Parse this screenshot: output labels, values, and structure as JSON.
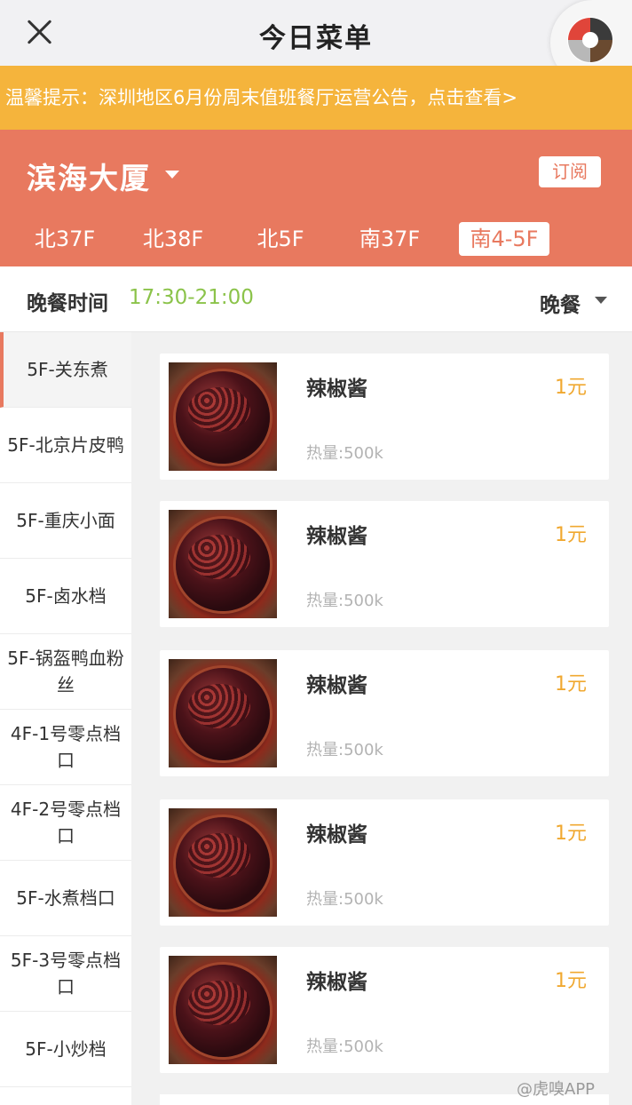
{
  "header": {
    "title": "今日菜单"
  },
  "notice": {
    "text": "温馨提示：深圳地区6月份周末值班餐厅运营公告，点击查看>"
  },
  "location": {
    "building": "滨海大厦",
    "subscribe_label": "订阅",
    "floors": [
      "北37F",
      "北38F",
      "北5F",
      "南37F",
      "南4-5F"
    ],
    "active_floor": "南4-5F"
  },
  "meal": {
    "time_label": "晚餐时间",
    "time_range": "17:30-21:00",
    "selected": "晚餐"
  },
  "sidebar": {
    "items": [
      {
        "label": "5F-关东煮"
      },
      {
        "label": "5F-北京片皮鸭"
      },
      {
        "label": "5F-重庆小面"
      },
      {
        "label": "5F-卤水档"
      },
      {
        "label": "5F-锅盔鸭血粉丝"
      },
      {
        "label": "4F-1号零点档口"
      },
      {
        "label": "4F-2号零点档口"
      },
      {
        "label": "5F-水煮档口"
      },
      {
        "label": "5F-3号零点档口"
      },
      {
        "label": "5F-小炒档"
      }
    ],
    "active_index": 0
  },
  "dishes": [
    {
      "name": "辣椒酱",
      "price": "1元",
      "calories": "热量:500k"
    },
    {
      "name": "辣椒酱",
      "price": "1元",
      "calories": "热量:500k"
    },
    {
      "name": "辣椒酱",
      "price": "1元",
      "calories": "热量:500k"
    },
    {
      "name": "辣椒酱",
      "price": "1元",
      "calories": "热量:500k"
    },
    {
      "name": "辣椒酱",
      "price": "1元",
      "calories": "热量:500k"
    }
  ],
  "watermark": "@虎嗅APP",
  "colors": {
    "accent": "#e8795f",
    "notice": "#f5b43c",
    "time": "#8bc34a",
    "price": "#f0a830"
  }
}
